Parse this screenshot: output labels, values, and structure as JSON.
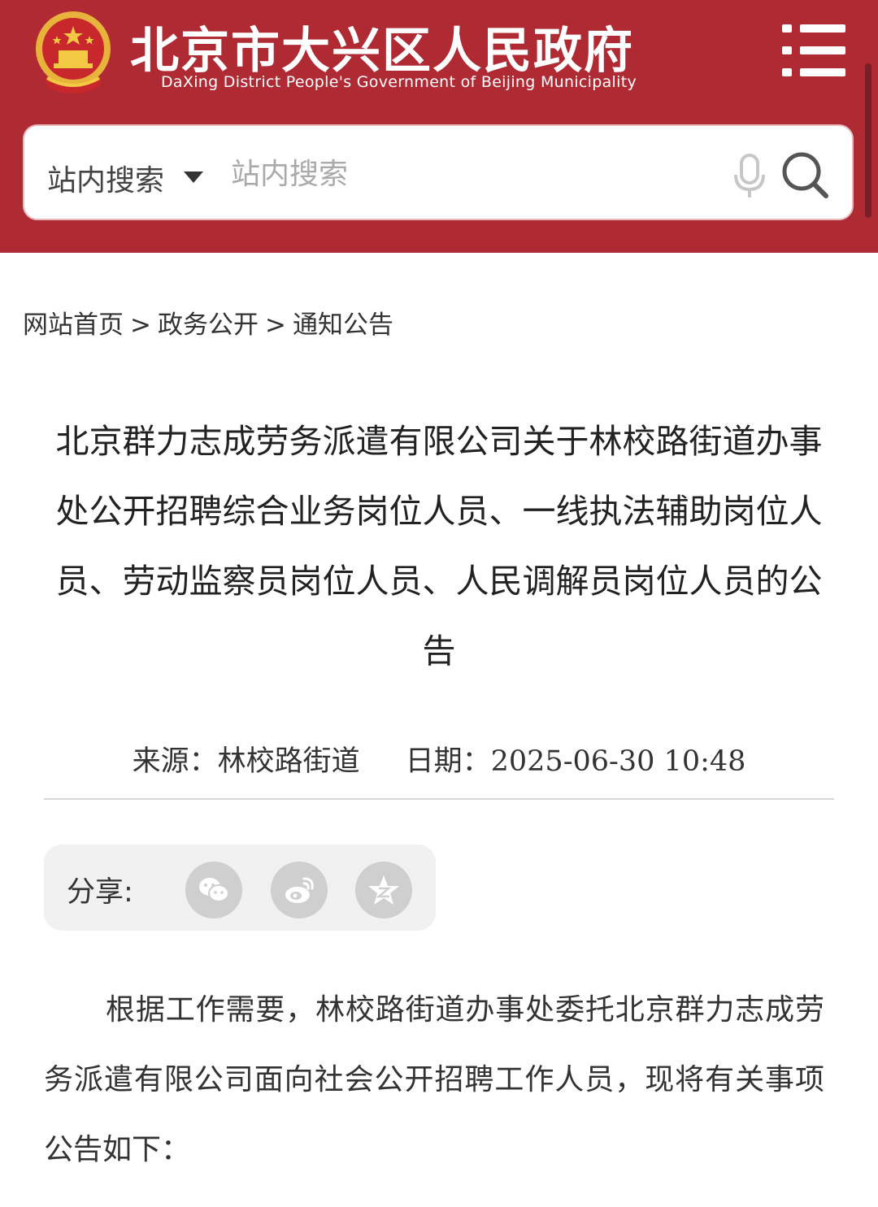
{
  "header": {
    "title_cn": "北京市大兴区人民政府",
    "title_en": "DaXing District People's Government of Beijing Municipality",
    "emblem_icon": "national-emblem-icon",
    "menu_icon": "menu-list-icon",
    "brand_color": "#b02a34"
  },
  "search": {
    "scope_label": "站内搜索",
    "placeholder": "站内搜索",
    "mic_icon": "microphone-icon",
    "search_icon": "search-icon"
  },
  "breadcrumb": {
    "items": [
      "网站首页",
      "政务公开",
      "通知公告"
    ],
    "separator": ">"
  },
  "article": {
    "title": "北京群力志成劳务派遣有限公司关于林校路街道办事处公开招聘综合业务岗位人员、一线执法辅助岗位人员、劳动监察员岗位人员、人民调解员岗位人员的公告",
    "source_label": "来源：",
    "source_value": "林校路街道",
    "date_label": "日期：",
    "date_value": "2025-06-30 10:48",
    "share_label": "分享:",
    "share_icons": [
      "wechat-icon",
      "weibo-icon",
      "qzone-icon"
    ],
    "body": "根据工作需要，林校路街道办事处委托北京群力志成劳务派遣有限公司面向社会公开招聘工作人员，现将有关事项公告如下："
  }
}
